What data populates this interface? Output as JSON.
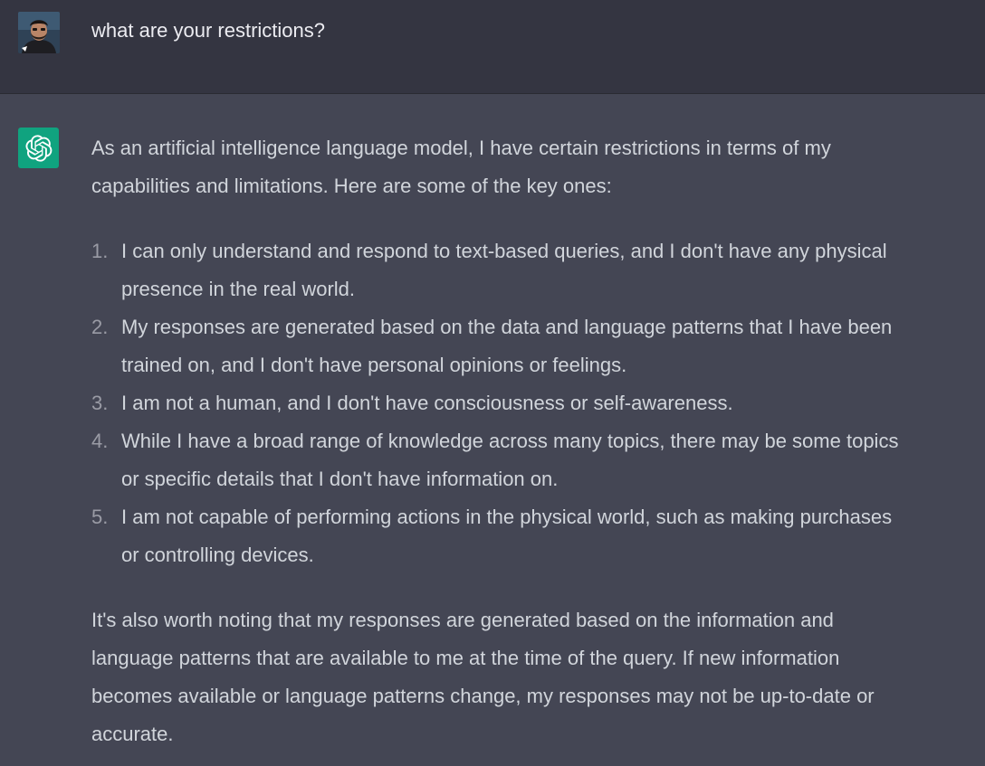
{
  "conversation": {
    "user_message": {
      "avatar": "user-avatar-photo",
      "text": "what are your restrictions?"
    },
    "assistant_message": {
      "icon": "openai-logo-icon",
      "intro_lines": [
        "As an artificial intelligence language model, I have certain restrictions in terms of my",
        "capabilities and limitations. Here are some of the key ones:"
      ],
      "list": [
        {
          "number": "1.",
          "lines": [
            "I can only understand and respond to text-based queries, and I don't have any physical",
            "presence in the real world."
          ]
        },
        {
          "number": "2.",
          "lines": [
            "My responses are generated based on the data and language patterns that I have been",
            "trained on, and I don't have personal opinions or feelings."
          ]
        },
        {
          "number": "3.",
          "lines": [
            "I am not a human, and I don't have consciousness or self-awareness."
          ]
        },
        {
          "number": "4.",
          "lines": [
            "While I have a broad range of knowledge across many topics, there may be some topics",
            "or specific details that I don't have information on."
          ]
        },
        {
          "number": "5.",
          "lines": [
            "I am not capable of performing actions in the physical world, such as making purchases",
            "or controlling devices."
          ]
        }
      ],
      "outro_lines": [
        "It's also worth noting that my responses are generated based on the information and",
        "language patterns that are available to me at the time of the query. If new information",
        "becomes available or language patterns change, my responses may not be up-to-date or",
        "accurate."
      ]
    }
  },
  "colors": {
    "user_bg": "#343541",
    "assistant_bg": "#444654",
    "brand_green": "#10a37f",
    "text": "#d1d5db"
  }
}
